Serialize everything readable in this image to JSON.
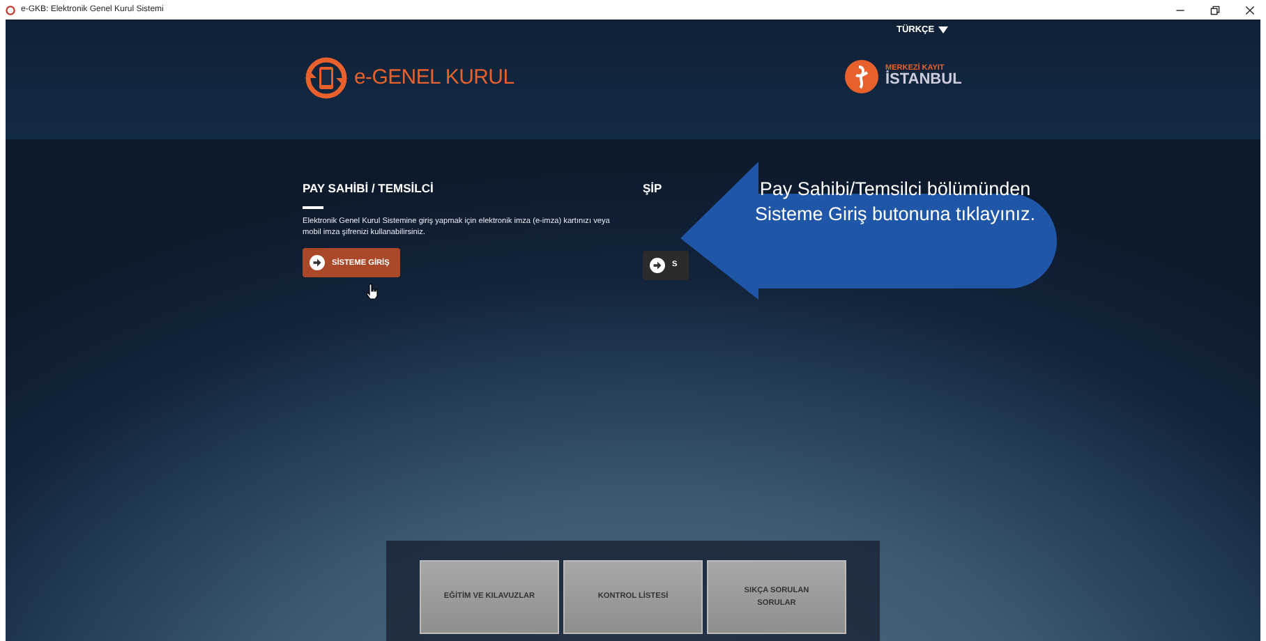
{
  "window": {
    "title": "e-GKB: Elektronik Genel Kurul Sistemi"
  },
  "language": {
    "label": "TÜRKÇE"
  },
  "header": {
    "logo_text": "e-GENEL KURUL",
    "partner_line_1": "MERKEZİ KAYIT",
    "partner_line_2": "İSTANBUL"
  },
  "sections": [
    {
      "heading": "PAY SAHİBİ / TEMSİLCİ",
      "description": "Elektronik Genel Kurul Sistemine giriş yapmak için elektronik imza (e-imza) kartınızı veya mobil imza şifrenizi kullanabilirsiniz.",
      "button": "SİSTEME GİRİŞ"
    },
    {
      "heading": "ŞİP",
      "button": "S"
    }
  ],
  "callout": {
    "text": "Pay Sahibi/Temsilci bölümünden Sisteme Giriş butonuna tıklayınız."
  },
  "bottom_buttons": [
    "EĞİTİM VE KILAVUZLAR",
    "KONTROL LİSTESİ",
    "SIKÇA SORULAN SORULAR"
  ]
}
